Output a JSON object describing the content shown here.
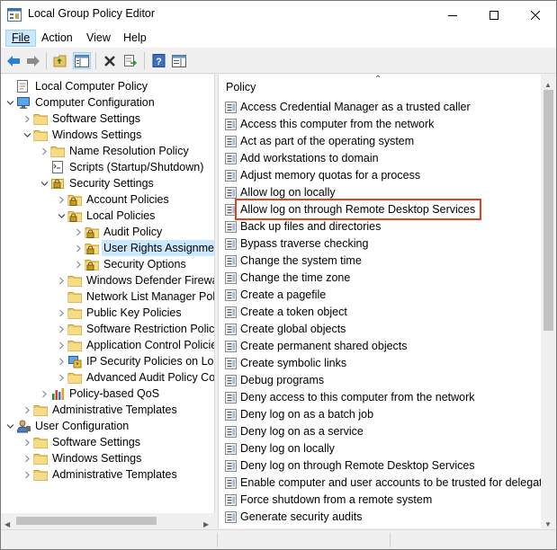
{
  "window": {
    "title": "Local Group Policy Editor"
  },
  "menu": [
    {
      "label": "File"
    },
    {
      "label": "Action"
    },
    {
      "label": "View"
    },
    {
      "label": "Help"
    }
  ],
  "tree": [
    {
      "label": "Local Computer Policy",
      "icon": "computer-policy-icon",
      "level": 0,
      "expander": "none"
    },
    {
      "label": "Computer Configuration",
      "icon": "computer-icon",
      "level": 0,
      "expander": "open"
    },
    {
      "label": "Software Settings",
      "icon": "folder-icon",
      "level": 1,
      "expander": "closed"
    },
    {
      "label": "Windows Settings",
      "icon": "folder-icon",
      "level": 1,
      "expander": "open"
    },
    {
      "label": "Name Resolution Policy",
      "icon": "folder-icon",
      "level": 2,
      "expander": "closed"
    },
    {
      "label": "Scripts (Startup/Shutdown)",
      "icon": "scripts-icon",
      "level": 2,
      "expander": "none"
    },
    {
      "label": "Security Settings",
      "icon": "security-settings-icon",
      "level": 2,
      "expander": "open"
    },
    {
      "label": "Account Policies",
      "icon": "folder-lock-icon",
      "level": 3,
      "expander": "closed"
    },
    {
      "label": "Local Policies",
      "icon": "folder-lock-icon",
      "level": 3,
      "expander": "open"
    },
    {
      "label": "Audit Policy",
      "icon": "folder-lock-icon",
      "level": 4,
      "expander": "closed"
    },
    {
      "label": "User Rights Assignment",
      "icon": "folder-lock-icon",
      "level": 4,
      "expander": "closed",
      "selected": true
    },
    {
      "label": "Security Options",
      "icon": "folder-lock-icon",
      "level": 4,
      "expander": "closed"
    },
    {
      "label": "Windows Defender Firewall with Advanced Security",
      "icon": "folder-icon",
      "level": 3,
      "expander": "closed"
    },
    {
      "label": "Network List Manager Policies",
      "icon": "folder-icon",
      "level": 3,
      "expander": "none"
    },
    {
      "label": "Public Key Policies",
      "icon": "folder-icon",
      "level": 3,
      "expander": "closed"
    },
    {
      "label": "Software Restriction Policies",
      "icon": "folder-icon",
      "level": 3,
      "expander": "closed"
    },
    {
      "label": "Application Control Policies",
      "icon": "folder-icon",
      "level": 3,
      "expander": "closed"
    },
    {
      "label": "IP Security Policies on Local Computer",
      "icon": "ip-security-icon",
      "level": 3,
      "expander": "closed"
    },
    {
      "label": "Advanced Audit Policy Configuration",
      "icon": "folder-icon",
      "level": 3,
      "expander": "closed"
    },
    {
      "label": "Policy-based QoS",
      "icon": "chart-icon",
      "level": 2,
      "expander": "closed"
    },
    {
      "label": "Administrative Templates",
      "icon": "folder-icon",
      "level": 1,
      "expander": "closed"
    },
    {
      "label": "User Configuration",
      "icon": "user-icon",
      "level": 0,
      "expander": "open"
    },
    {
      "label": "Software Settings",
      "icon": "folder-icon",
      "level": 1,
      "expander": "closed"
    },
    {
      "label": "Windows Settings",
      "icon": "folder-icon",
      "level": 1,
      "expander": "closed"
    },
    {
      "label": "Administrative Templates",
      "icon": "folder-icon",
      "level": 1,
      "expander": "closed"
    }
  ],
  "list": {
    "column_header": "Policy",
    "rows": [
      "Access Credential Manager as a trusted caller",
      "Access this computer from the network",
      "Act as part of the operating system",
      "Add workstations to domain",
      "Adjust memory quotas for a process",
      "Allow log on locally",
      "Allow log on through Remote Desktop Services",
      "Back up files and directories",
      "Bypass traverse checking",
      "Change the system time",
      "Change the time zone",
      "Create a pagefile",
      "Create a token object",
      "Create global objects",
      "Create permanent shared objects",
      "Create symbolic links",
      "Debug programs",
      "Deny access to this computer from the network",
      "Deny log on as a batch job",
      "Deny log on as a service",
      "Deny log on locally",
      "Deny log on through Remote Desktop Services",
      "Enable computer and user accounts to be trusted for delegation",
      "Force shutdown from a remote system",
      "Generate security audits"
    ],
    "highlighted_row": "Allow log on through Remote Desktop Services"
  },
  "colors": {
    "highlight_box": "#e0431f",
    "selection": "#cce8ff"
  }
}
